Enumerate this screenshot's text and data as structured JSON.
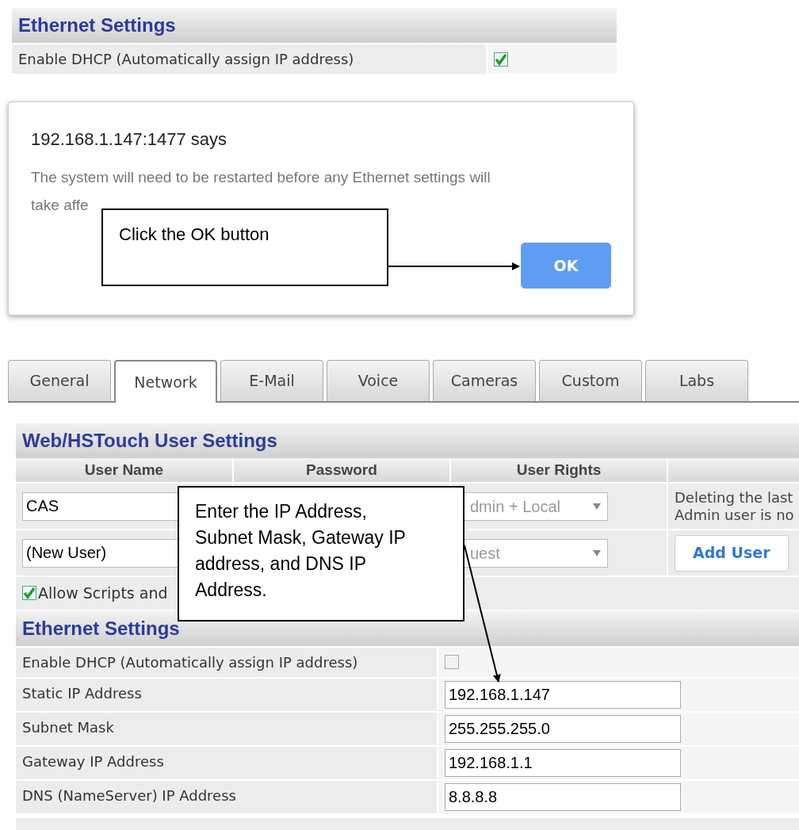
{
  "top_panel": {
    "title": "Ethernet Settings",
    "rows": [
      {
        "kind": "checkbox",
        "label": "Enable DHCP (Automatically assign IP address)",
        "checked": true
      }
    ]
  },
  "dialog": {
    "title": "192.168.1.147:1477 says",
    "message_lines": [
      "The system will need to be restarted before any Ethernet settings will",
      "take affe"
    ],
    "button": "OK"
  },
  "callouts": [
    {
      "text": "Click the OK button"
    },
    {
      "text": "Enter the IP Address, Subnet Mask, Gateway IP address, and DNS IP Address."
    }
  ],
  "tabs": [
    {
      "label": "General",
      "selected": false
    },
    {
      "label": "Network",
      "selected": true
    },
    {
      "label": "E-Mail",
      "selected": false
    },
    {
      "label": "Voice",
      "selected": false
    },
    {
      "label": "Cameras",
      "selected": false
    },
    {
      "label": "Custom",
      "selected": false
    },
    {
      "label": "Labs",
      "selected": false
    }
  ],
  "user_settings": {
    "title": "Web/HSTouch User Settings",
    "columns": [
      "User Name",
      "Password",
      "User Rights"
    ],
    "rows": [
      {
        "user_name": "CAS",
        "rights": "dmin + Local",
        "note_lines": [
          "Deleting the last",
          "Admin user is no"
        ]
      },
      {
        "user_name": "(New User)",
        "rights": "uest",
        "button": "Add User"
      }
    ],
    "option": {
      "label": "Allow Scripts and",
      "checked": true
    }
  },
  "ethernet_settings": {
    "title": "Ethernet Settings",
    "rows": [
      {
        "kind": "checkbox",
        "label": "Enable DHCP (Automatically assign IP address)",
        "checked": false
      },
      {
        "kind": "text",
        "label": "Static IP Address",
        "value": "192.168.1.147"
      },
      {
        "kind": "text",
        "label": "Subnet Mask",
        "value": "255.255.255.0"
      },
      {
        "kind": "text",
        "label": "Gateway IP Address",
        "value": "192.168.1.1"
      },
      {
        "kind": "text",
        "label": "DNS (NameServer) IP Address",
        "value": "8.8.8.8"
      }
    ]
  }
}
